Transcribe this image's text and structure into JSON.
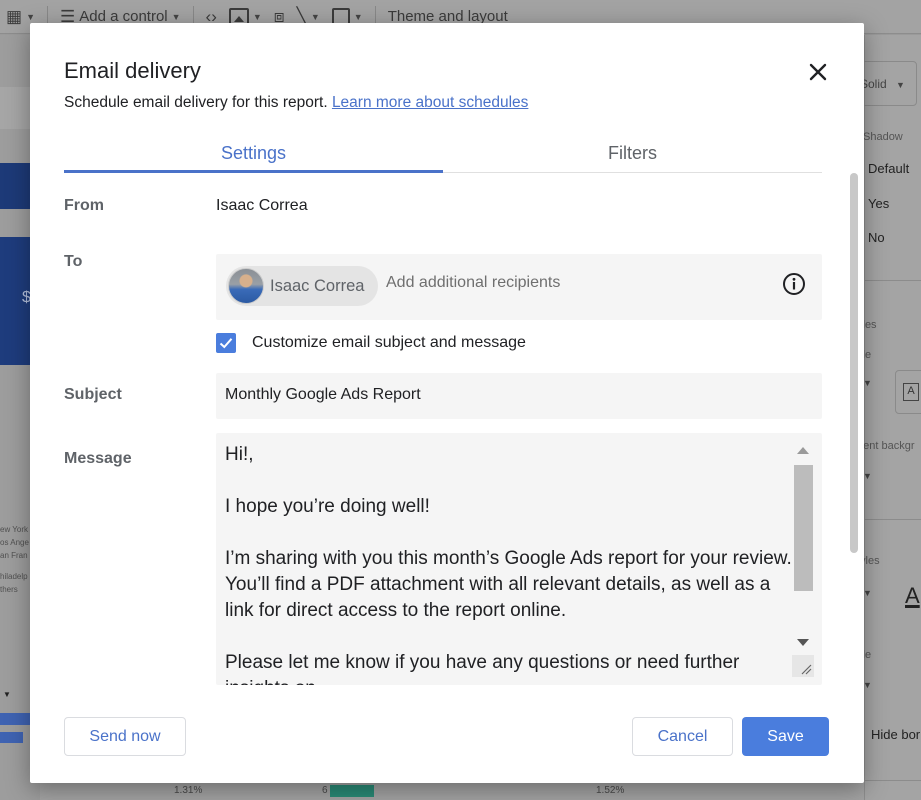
{
  "background": {
    "toolbar": {
      "add_control_label": "Add a control",
      "theme_layout_label": "Theme and layout"
    },
    "left_panel": {
      "currency_symbol": "$",
      "city_list": [
        "ew York",
        "os Ange",
        "an Fran",
        "",
        "hiladelp",
        "thers"
      ]
    },
    "right_panel": {
      "border_style_value": "Solid",
      "shadow_label": "Shadow",
      "shadow_options": [
        "Default",
        "Yes",
        "No"
      ],
      "styles_label_1": "yles",
      "style_label_1": "yle",
      "component_background_label": "nent backgr",
      "styles_label_2": "tyles",
      "style_label_2": "yle",
      "hide_border_label": "Hide bor"
    },
    "bottom_strip": {
      "value_1": "1.31%",
      "value_2": "6",
      "value_3": "1.52%"
    }
  },
  "dialog": {
    "title": "Email delivery",
    "subtitle": "Schedule email delivery for this report.",
    "learn_more_link": "Learn more about schedules",
    "tabs": [
      {
        "label": "Settings",
        "active": true
      },
      {
        "label": "Filters",
        "active": false
      }
    ],
    "from": {
      "label": "From",
      "value": "Isaac Correa"
    },
    "to": {
      "label": "To",
      "recipients": [
        {
          "name": "Isaac Correa"
        }
      ],
      "placeholder": "Add additional recipients"
    },
    "customize": {
      "label": "Customize email subject and message",
      "checked": true
    },
    "subject": {
      "label": "Subject",
      "value": "Monthly Google Ads Report"
    },
    "message": {
      "label": "Message",
      "value": "Hi!,\n\nI hope you’re doing well!\n\nI’m sharing with you this month’s Google Ads report for your review. You’ll find a PDF attachment with all relevant details, as well as a link for direct access to the report online.\n\nPlease let me know if you have any questions or need further insights on"
    },
    "buttons": {
      "send_now": "Send now",
      "cancel": "Cancel",
      "save": "Save"
    },
    "colors": {
      "accent": "#4a72c9",
      "primary_button": "#4a7ddd"
    }
  }
}
